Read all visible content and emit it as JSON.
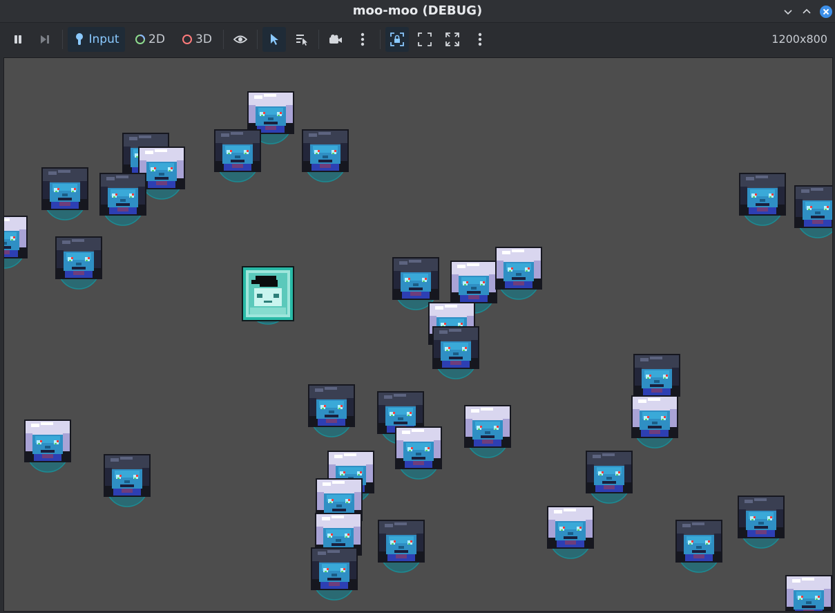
{
  "window": {
    "title": "moo-moo (DEBUG)",
    "controls": [
      "minimize-icon",
      "maximize-icon",
      "close-icon"
    ]
  },
  "toolbar": {
    "pause_icon": "pause-icon",
    "step_icon": "step-forward-icon",
    "input_label": "Input",
    "mode_2d_label": "2D",
    "mode_3d_label": "3D",
    "visibility_icon": "eye-icon",
    "select_icon": "pointer-icon",
    "list_select_icon": "list-select-icon",
    "camera_icon": "camera-icon",
    "more_icon_1": "more-vertical-icon",
    "lock_icon": "lock-icon",
    "fullscreen_icon": "fullscreen-icon",
    "expand_icon": "expand-icon",
    "more_icon_2": "more-vertical-icon",
    "resolution": "1200x800"
  },
  "colors": {
    "accent": "#8ac9ff",
    "viewport_bg": "#4d4d4d",
    "enemy_dark_hair": "#3a3f52",
    "enemy_white_hair": "#d9d6ef",
    "enemy_face": "#2f8fc4",
    "player_outline": "#28b9a6"
  },
  "scene": {
    "player": {
      "sprite": "teal-cube-player"
    },
    "enemies": [
      {
        "hair": "white"
      },
      {
        "hair": "dark"
      },
      {
        "hair": "dark"
      },
      {
        "hair": "dark"
      },
      {
        "hair": "white"
      },
      {
        "hair": "dark"
      },
      {
        "hair": "dark"
      },
      {
        "hair": "white"
      },
      {
        "hair": "dark"
      },
      {
        "hair": "dark"
      },
      {
        "hair": "dark"
      },
      {
        "hair": "dark"
      },
      {
        "hair": "white"
      },
      {
        "hair": "white"
      },
      {
        "hair": "white"
      },
      {
        "hair": "dark"
      },
      {
        "hair": "dark"
      },
      {
        "hair": "white"
      },
      {
        "hair": "dark"
      },
      {
        "hair": "dark"
      },
      {
        "hair": "white"
      },
      {
        "hair": "white"
      },
      {
        "hair": "white"
      },
      {
        "hair": "dark"
      },
      {
        "hair": "dark"
      },
      {
        "hair": "white"
      },
      {
        "hair": "white"
      },
      {
        "hair": "dark"
      },
      {
        "hair": "white"
      },
      {
        "hair": "dark"
      },
      {
        "hair": "white"
      },
      {
        "hair": "dark"
      },
      {
        "hair": "dark"
      },
      {
        "hair": "white"
      },
      {
        "hair": "white"
      }
    ]
  }
}
